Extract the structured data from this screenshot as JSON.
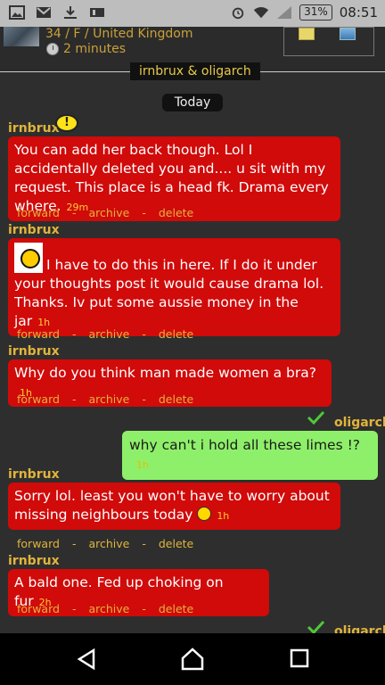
{
  "status": {
    "battery": "31%",
    "clock": "08:51"
  },
  "header": {
    "meta": "34 / F / United Kingdom",
    "time": "2 minutes"
  },
  "thread": {
    "title": "irnbrux & oligarch"
  },
  "day_label": "Today",
  "actions": {
    "forward": "forward",
    "archive": "archive",
    "delete": "delete",
    "sep": "-"
  },
  "messages": [
    {
      "sender": "irnbrux",
      "text": "You can add her back though. Lol I accidentally deleted you and.... u sit with my request. This place is a head fk. Drama every where.",
      "time": "29m"
    },
    {
      "sender": "irnbrux",
      "text": "I have to do this in here. If I do it under your thoughts post it would cause drama lol. Thanks. Iv put some aussie money in the jar",
      "time": "1h"
    },
    {
      "sender": "irnbrux",
      "text": "Why do you think man made women a bra?",
      "time": "1h"
    },
    {
      "sender": "oligarch",
      "text": "why can't i hold all these limes !?",
      "time": "1h"
    },
    {
      "sender": "irnbrux",
      "text": "Sorry lol. least you won't have to worry about missing neighbours today",
      "time": "1h"
    },
    {
      "sender": "irnbrux",
      "text": "A bald one. Fed up choking on fur",
      "time": "2h"
    },
    {
      "sender": "oligarch",
      "text": "oligarch"
    }
  ],
  "colors": {
    "received_bubble": "#d10a0a",
    "sent_bubble": "#8ef06a",
    "accent": "#e0b43c"
  }
}
